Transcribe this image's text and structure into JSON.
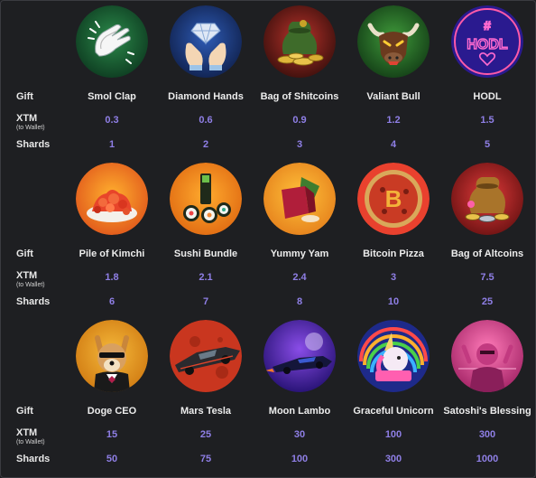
{
  "labels": {
    "gift": "Gift",
    "xtm": "XTM",
    "xtm_sub": "(to Wallet)",
    "shards": "Shards"
  },
  "colors": {
    "background": "#1e1f22",
    "value_purple": "#8f7fe6",
    "label_white": "#e8e8e8"
  },
  "sections": [
    {
      "gifts": [
        {
          "name": "Smol Clap",
          "xtm": "0.3",
          "shards": "1",
          "icon": "clapping-hands-icon"
        },
        {
          "name": "Diamond Hands",
          "xtm": "0.6",
          "shards": "2",
          "icon": "diamond-hands-icon"
        },
        {
          "name": "Bag of Shitcoins",
          "xtm": "0.9",
          "shards": "3",
          "icon": "coin-bag-icon"
        },
        {
          "name": "Valiant Bull",
          "xtm": "1.2",
          "shards": "4",
          "icon": "bull-icon"
        },
        {
          "name": "HODL",
          "xtm": "1.5",
          "shards": "5",
          "icon": "hodl-neon-icon"
        }
      ]
    },
    {
      "gifts": [
        {
          "name": "Pile of Kimchi",
          "xtm": "1.8",
          "shards": "6",
          "icon": "kimchi-icon"
        },
        {
          "name": "Sushi Bundle",
          "xtm": "2.1",
          "shards": "7",
          "icon": "sushi-icon"
        },
        {
          "name": "Yummy Yam",
          "xtm": "2.4",
          "shards": "8",
          "icon": "yam-icon"
        },
        {
          "name": "Bitcoin Pizza",
          "xtm": "3",
          "shards": "10",
          "icon": "bitcoin-pizza-icon"
        },
        {
          "name": "Bag of Altcoins",
          "xtm": "7.5",
          "shards": "25",
          "icon": "altcoin-bag-icon"
        }
      ]
    },
    {
      "gifts": [
        {
          "name": "Doge CEO",
          "xtm": "15",
          "shards": "50",
          "icon": "doge-ceo-icon"
        },
        {
          "name": "Mars Tesla",
          "xtm": "25",
          "shards": "75",
          "icon": "mars-tesla-icon"
        },
        {
          "name": "Moon Lambo",
          "xtm": "30",
          "shards": "100",
          "icon": "moon-lambo-icon"
        },
        {
          "name": "Graceful Unicorn",
          "xtm": "100",
          "shards": "300",
          "icon": "unicorn-icon"
        },
        {
          "name": "Satoshi's Blessing",
          "xtm": "300",
          "shards": "1000",
          "icon": "satoshi-blessing-icon"
        }
      ]
    }
  ]
}
